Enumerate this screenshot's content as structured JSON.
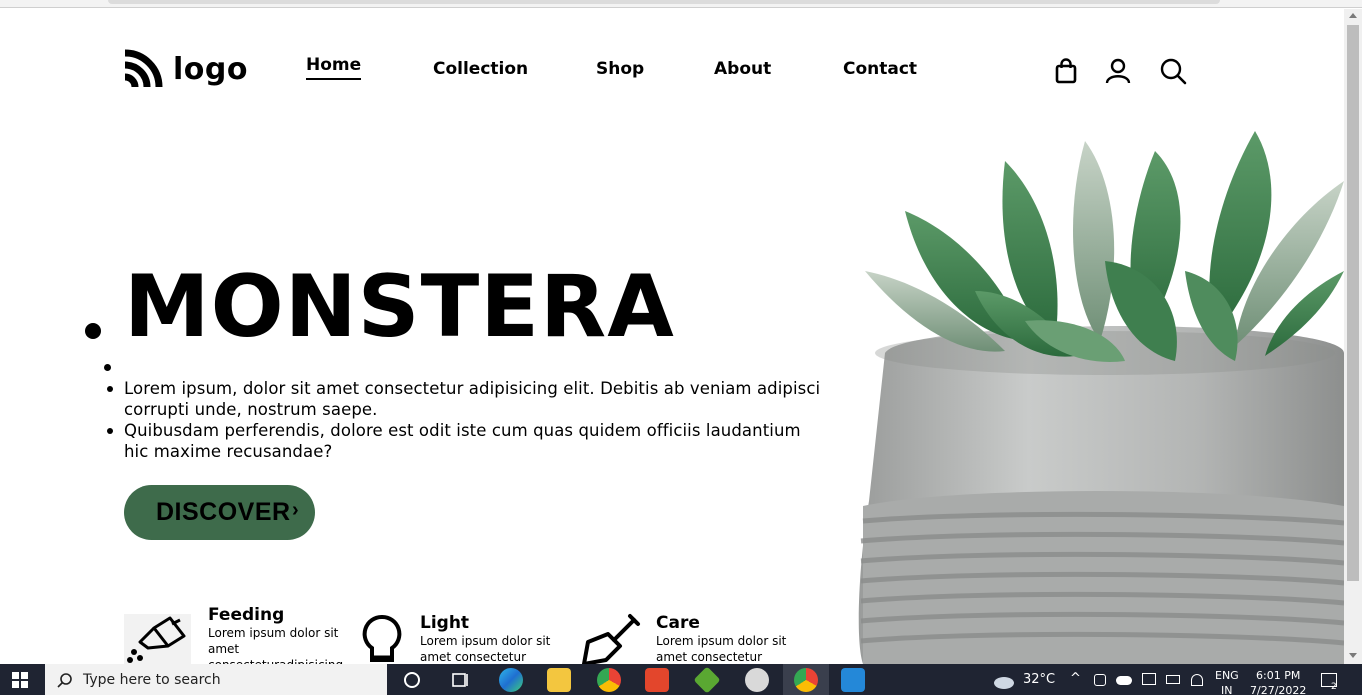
{
  "brand": {
    "logo_text": "logo"
  },
  "nav": {
    "items": [
      "Home",
      "Collection",
      "Shop",
      "About",
      "Contact"
    ],
    "active": "Home"
  },
  "header_icons": [
    "shopping-bag-icon",
    "user-icon",
    "search-icon"
  ],
  "hero": {
    "title": "MONSTERA",
    "bullets": [
      "Lorem ipsum, dolor sit amet consectetur adipisicing elit. Debitis ab veniam adipisci corrupti unde, nostrum saepe.",
      "Quibusdam perferendis, dolore est odit iste cum quas quidem officiis laudantium hic maxime recusandae?"
    ],
    "cta_label": "DISCOVER",
    "cta_color": "#3e6b4b"
  },
  "features": [
    {
      "title": "Feeding",
      "text": "Lorem ipsum dolor sit amet consecteturadipisicing",
      "icon": "watering-can-icon"
    },
    {
      "title": "Light",
      "text": "Lorem ipsum dolor sit amet consectetur",
      "icon": "light-bulb-icon"
    },
    {
      "title": "Care",
      "text": "Lorem ipsum dolor sit amet consectetur",
      "icon": "shovel-icon"
    }
  ],
  "taskbar": {
    "search_placeholder": "Type here to search",
    "weather": "32°C",
    "language": "ENG",
    "region": "IN",
    "time": "6:01 PM",
    "date": "7/27/2022",
    "notifications": "2"
  }
}
